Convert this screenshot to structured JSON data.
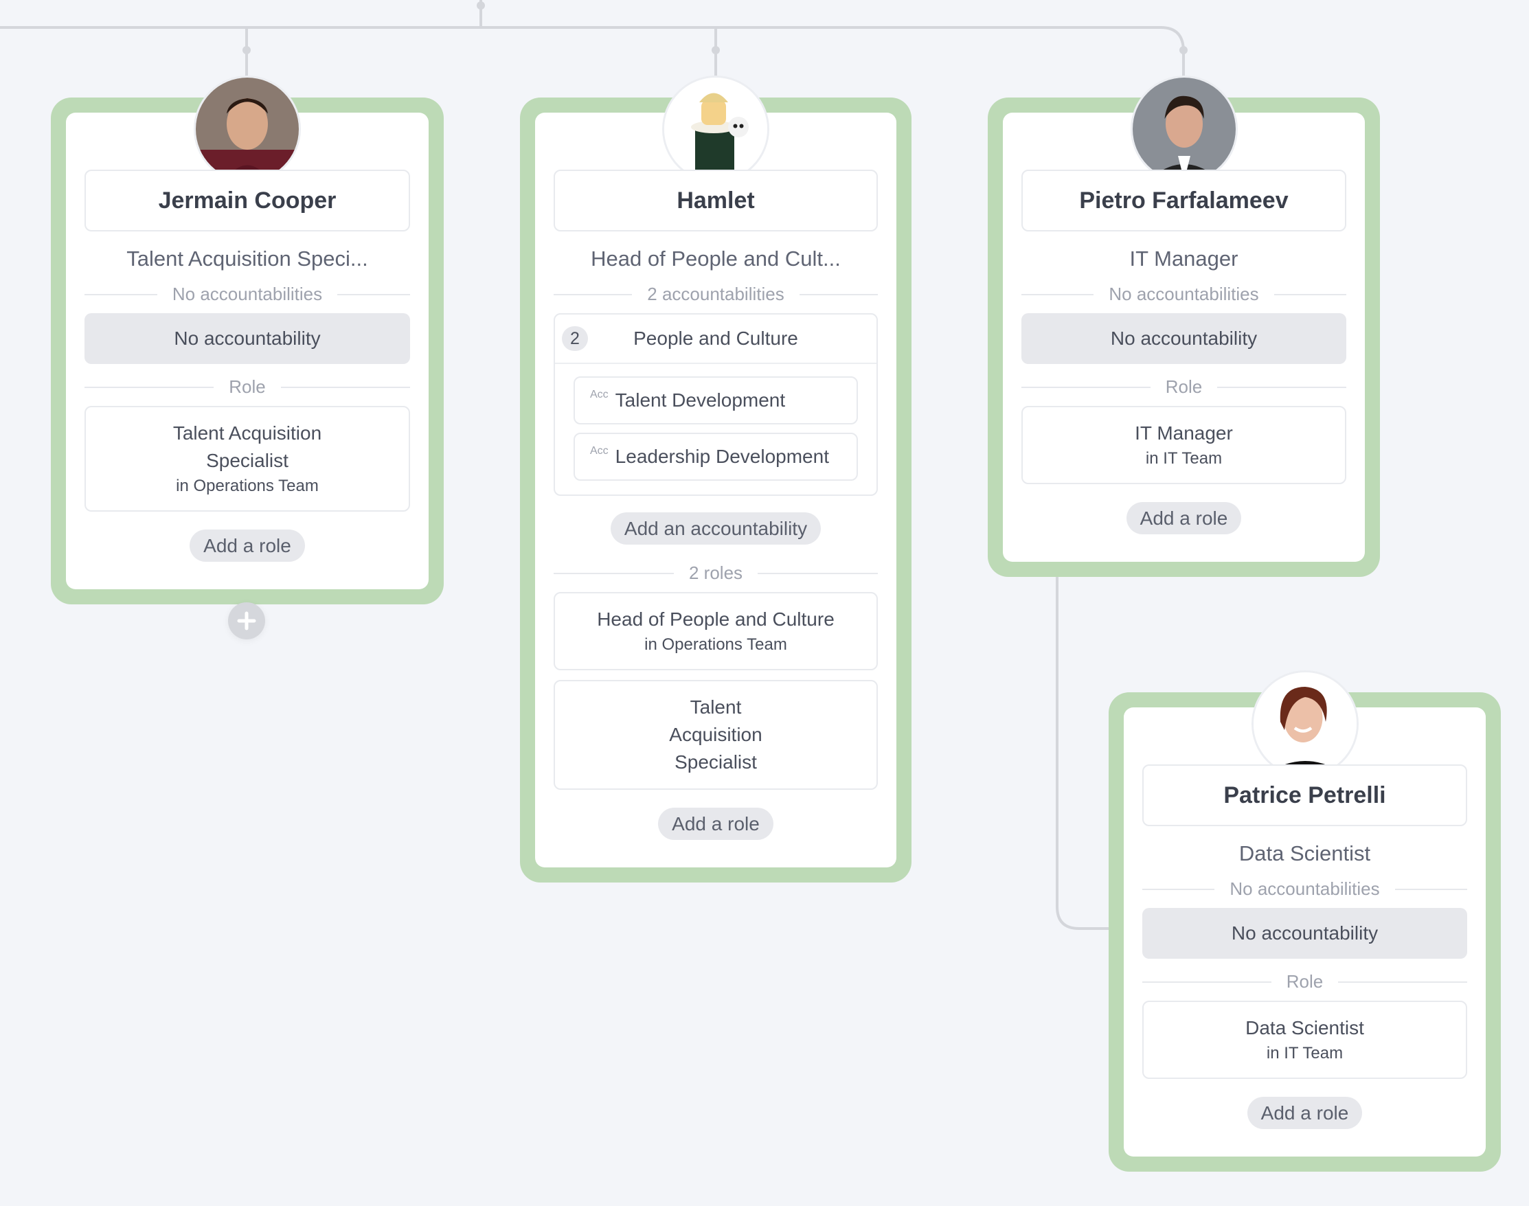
{
  "colors": {
    "card_border": "#bddab6",
    "connector": "#d4d6db",
    "background": "#f3f5f9"
  },
  "cards": [
    {
      "name": "Jermain Cooper",
      "title": "Talent Acquisition Speci...",
      "acc_label": "No accountabilities",
      "no_acc": "No accountability",
      "role_label": "Role",
      "roles": [
        {
          "name": "Talent Acquisition Specialist",
          "team": "in Operations Team"
        }
      ],
      "add_role": "Add a role",
      "avatar": "photo-young-man"
    },
    {
      "name": "Hamlet",
      "title": "Head of People and Cult...",
      "acc_label": "2 accountabilities",
      "circle": {
        "count": "2",
        "name": "People and Culture",
        "items": [
          {
            "tag": "Acc",
            "name": "Talent Development"
          },
          {
            "tag": "Acc",
            "name": "Leadership Development"
          }
        ]
      },
      "add_acc": "Add an accountability",
      "role_label": "2 roles",
      "roles": [
        {
          "name": "Head of People and Culture",
          "team": "in Operations Team"
        },
        {
          "name": "Talent Acquisition Specialist",
          "team": ""
        }
      ],
      "add_role": "Add a role",
      "avatar": "lego-hamlet"
    },
    {
      "name": "Pietro Farfalameev",
      "title": "IT Manager",
      "acc_label": "No accountabilities",
      "no_acc": "No accountability",
      "role_label": "Role",
      "roles": [
        {
          "name": "IT Manager",
          "team": "in IT Team"
        }
      ],
      "add_role": "Add a role",
      "avatar": "photo-man-suit"
    },
    {
      "name": "Patrice Petrelli",
      "title": "Data Scientist",
      "acc_label": "No accountabilities",
      "no_acc": "No accountability",
      "role_label": "Role",
      "roles": [
        {
          "name": "Data Scientist",
          "team": "in IT Team"
        }
      ],
      "add_role": "Add a role",
      "avatar": "photo-woman"
    }
  ],
  "add_report_icon": "plus-icon"
}
